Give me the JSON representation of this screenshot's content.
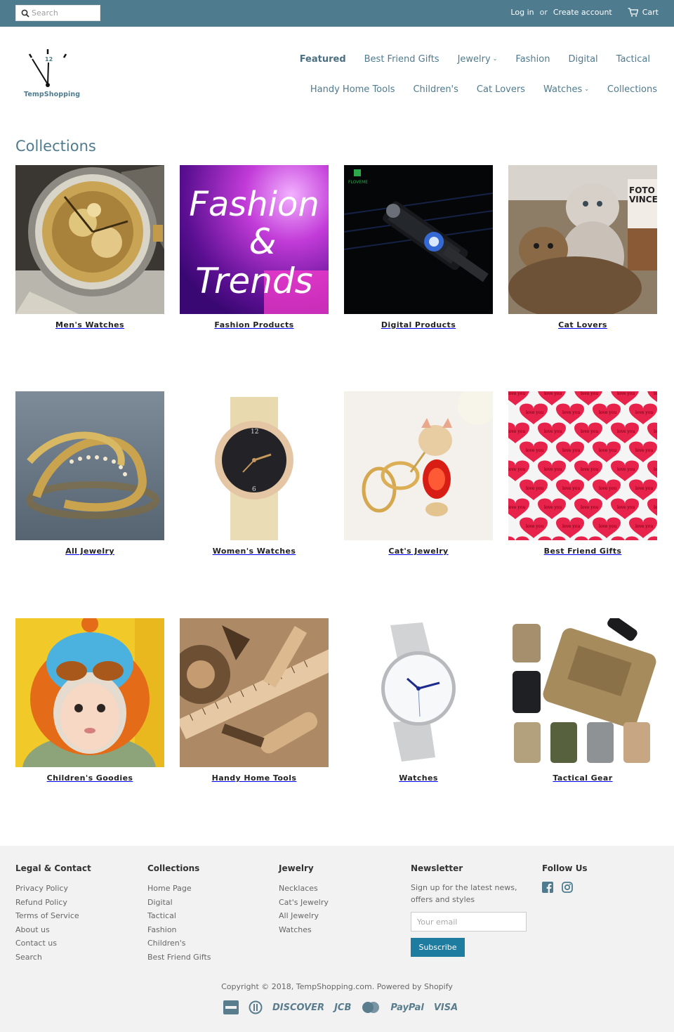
{
  "topbar": {
    "search_placeholder": "Search",
    "login": "Log in",
    "or": "or",
    "create_account": "Create account",
    "cart": "Cart"
  },
  "brand": {
    "logo_text": "TempShopping",
    "clock_number": "12"
  },
  "nav": {
    "row1": [
      "Featured",
      "Best Friend Gifts",
      "Jewelry",
      "Fashion",
      "Digital",
      "Tactical"
    ],
    "row2": [
      "Handy Home Tools",
      "Children's",
      "Cat Lovers",
      "Watches",
      "Collections"
    ]
  },
  "page_title": "Collections",
  "collections": [
    {
      "label": "Men's Watches"
    },
    {
      "label": "Fashion Products",
      "image_text_1": "Fashion",
      "image_text_2": "&",
      "image_text_3": "Trends"
    },
    {
      "label": "Digital Products",
      "image_text_1": "FLOVEME"
    },
    {
      "label": "Cat Lovers",
      "image_text_1": "FOTO",
      "image_text_2": "VINCE"
    },
    {
      "label": "All Jewelry"
    },
    {
      "label": "Women's Watches"
    },
    {
      "label": "Cat's Jewelry"
    },
    {
      "label": "Best Friend Gifts",
      "image_text_1": "love you"
    },
    {
      "label": "Children's Goodies"
    },
    {
      "label": "Handy Home Tools"
    },
    {
      "label": "Watches"
    },
    {
      "label": "Tactical Gear"
    }
  ],
  "footer": {
    "legal": {
      "heading": "Legal & Contact",
      "links": [
        "Privacy Policy",
        "Refund Policy",
        "Terms of Service",
        "About us",
        "Contact us",
        "Search"
      ]
    },
    "collections": {
      "heading": "Collections",
      "links": [
        "Home Page",
        "Digital",
        "Tactical",
        "Fashion",
        "Children's",
        "Best Friend Gifts"
      ]
    },
    "jewelry": {
      "heading": "Jewelry",
      "links": [
        "Necklaces",
        "Cat's Jewelry",
        "All Jewelry",
        "Watches"
      ]
    },
    "newsletter": {
      "heading": "Newsletter",
      "text": "Sign up for the latest news, offers and styles",
      "email_placeholder": "Your email",
      "button": "Subscribe"
    },
    "follow": {
      "heading": "Follow Us"
    },
    "copyright": "Copyright © 2018, TempShopping.com. Powered by Shopify",
    "payments": [
      "AMEX",
      "DINERS",
      "DISCOVER",
      "JCB",
      "MASTER",
      "PayPal",
      "VISA"
    ]
  },
  "colors": {
    "topbar": "#4f7b8f",
    "accent": "#4f7b8f",
    "subscribe": "#1f7ca1",
    "footer_bg": "#f2f2f2"
  },
  "icons": [
    "search-icon",
    "cart-icon",
    "facebook-icon",
    "instagram-icon",
    "chevron-down-icon"
  ]
}
